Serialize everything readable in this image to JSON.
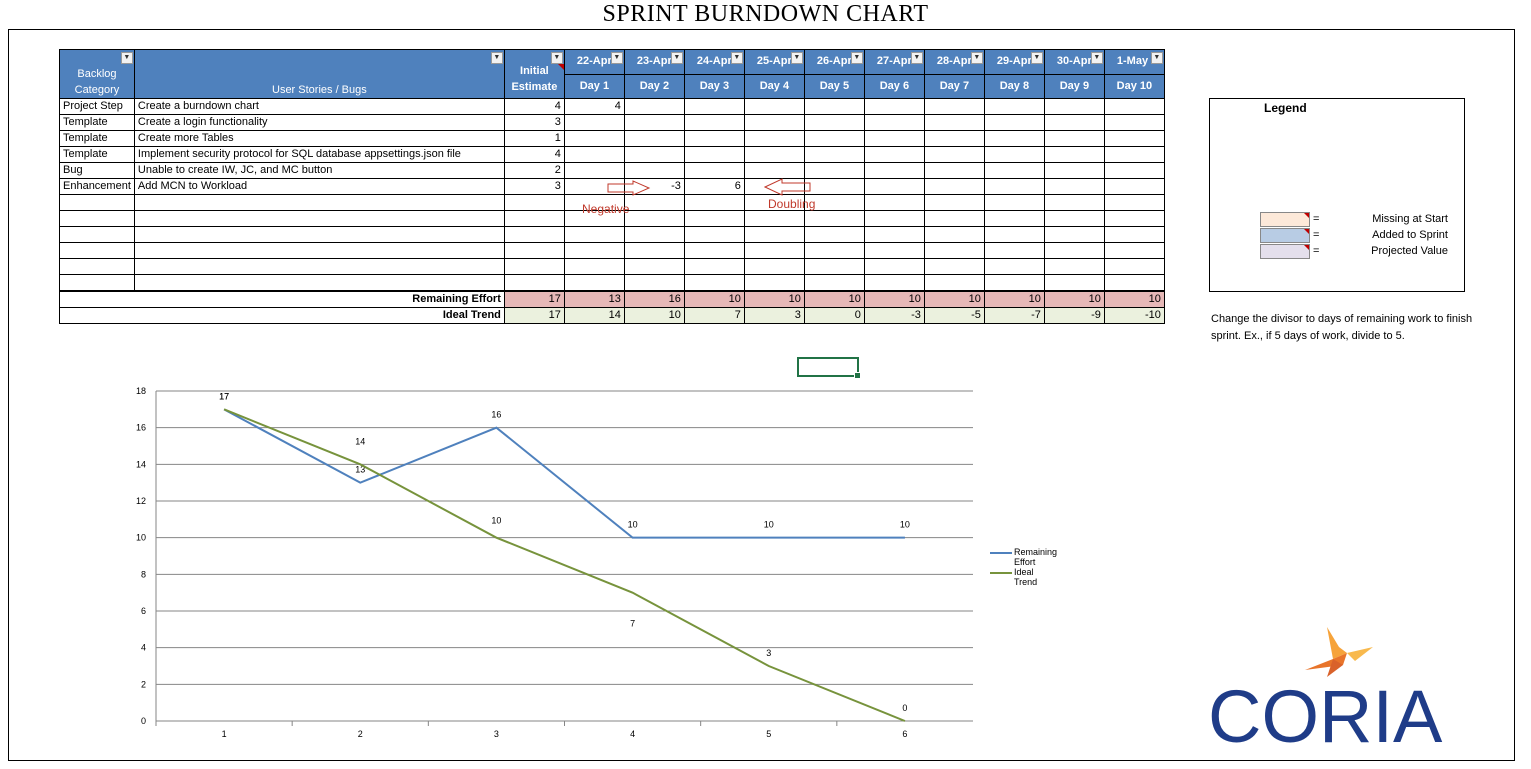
{
  "title": "SPRINT BURNDOWN CHART",
  "colors": {
    "header_blue": "#4f81bd",
    "remaining_effort_fill": "#e6b8b7",
    "ideal_trend_fill": "#ebf1de",
    "missing_at_start": "#fde9d9",
    "added_to_sprint": "#b8cce4",
    "projected_value": "#e4dfec",
    "series_remaining": "#4f81bd",
    "series_ideal": "#77933c",
    "logo_navy": "#1f3c88",
    "logo_orange": "#f39c2d"
  },
  "table": {
    "headers": {
      "category": "Backlog Category",
      "stories": "User Stories / Bugs",
      "estimate": "Initial Estimate",
      "dates": [
        "22-Apr",
        "23-Apr",
        "24-Apr",
        "25-Apr",
        "26-Apr",
        "27-Apr",
        "28-Apr",
        "29-Apr",
        "30-Apr",
        "1-May"
      ],
      "days": [
        "Day 1",
        "Day 2",
        "Day 3",
        "Day 4",
        "Day 5",
        "Day 6",
        "Day 7",
        "Day 8",
        "Day 9",
        "Day 10"
      ]
    },
    "rows": [
      {
        "category": "Project Step",
        "story": "Create a burndown chart",
        "estimate": "4",
        "days": [
          "4",
          "",
          "",
          "",
          "",
          "",
          "",
          "",
          "",
          ""
        ]
      },
      {
        "category": "Template",
        "story": "Create a login functionality",
        "estimate": "3",
        "days": [
          "",
          "",
          "",
          "",
          "",
          "",
          "",
          "",
          "",
          ""
        ]
      },
      {
        "category": "Template",
        "story": "Create more Tables",
        "estimate": "1",
        "days": [
          "",
          "",
          "",
          "",
          "",
          "",
          "",
          "",
          "",
          ""
        ]
      },
      {
        "category": "Template",
        "story": "Implement security protocol for SQL database appsettings.json file",
        "estimate": "4",
        "days": [
          "",
          "",
          "",
          "",
          "",
          "",
          "",
          "",
          "",
          ""
        ]
      },
      {
        "category": "Bug",
        "story": "Unable to create IW, JC, and MC button",
        "estimate": "2",
        "days": [
          "",
          "",
          "",
          "",
          "",
          "",
          "",
          "",
          "",
          ""
        ]
      },
      {
        "category": "Enhancement",
        "story": "Add MCN to Workload",
        "estimate": "3",
        "days": [
          "",
          "-3",
          "6",
          "",
          "",
          "",
          "",
          "",
          "",
          ""
        ]
      }
    ],
    "remaining_effort": {
      "label": "Remaining Effort",
      "values": [
        "17",
        "13",
        "16",
        "10",
        "10",
        "10",
        "10",
        "10",
        "10",
        "10",
        "10"
      ]
    },
    "ideal_trend": {
      "label": "Ideal Trend",
      "values": [
        "17",
        "14",
        "10",
        "7",
        "3",
        "0",
        "-3",
        "-5",
        "-7",
        "-9",
        "-10"
      ]
    }
  },
  "annotations": {
    "negative": "Negative",
    "doubling": "Doubling"
  },
  "legend": {
    "title": "Legend",
    "items": [
      {
        "eq": "=",
        "label": "Missing at Start"
      },
      {
        "eq": "=",
        "label": "Added to Sprint"
      },
      {
        "eq": "=",
        "label": "Projected Value"
      }
    ]
  },
  "note": "Change the divisor to days of remaining work to finish sprint. Ex., if 5 days of work, divide to 5.",
  "chart_data": {
    "type": "line",
    "x": [
      1,
      2,
      3,
      4,
      5,
      6
    ],
    "series": [
      {
        "name": "Remaining Effort",
        "values": [
          17,
          13,
          16,
          10,
          10,
          10
        ]
      },
      {
        "name": "Ideal Trend",
        "values": [
          17,
          14,
          10,
          7,
          3,
          0
        ]
      }
    ],
    "yticks": [
      "0",
      "2",
      "4",
      "6",
      "8",
      "10",
      "12",
      "14",
      "16",
      "18"
    ],
    "xticks": [
      "1",
      "2",
      "3",
      "4",
      "5",
      "6"
    ],
    "ylim": [
      0,
      18
    ],
    "grid": true,
    "legend_position": "right"
  },
  "logo": {
    "text": "CORIA"
  }
}
